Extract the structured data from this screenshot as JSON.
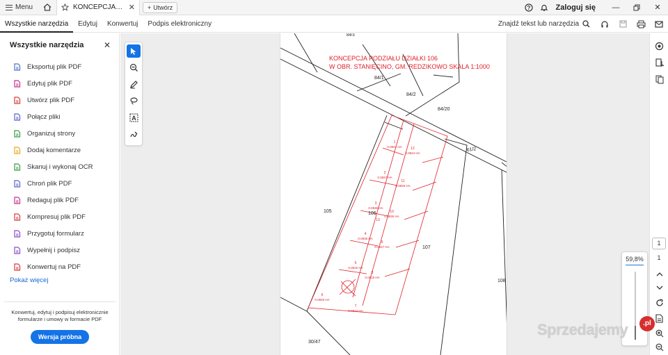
{
  "titlebar": {
    "menu_label": "Menu",
    "tab_title": "KONCEPCJA_PODZ...",
    "new_tab_label": "Utwórz",
    "login_label": "Zaloguj się"
  },
  "menubar": {
    "items": [
      "Wszystkie narzędzia",
      "Edytuj",
      "Konwertuj",
      "Podpis elektroniczny"
    ],
    "find_label": "Znajdź tekst lub narzędzia"
  },
  "left_panel": {
    "heading": "Wszystkie narzędzia",
    "tools": [
      {
        "label": "Eksportuj plik PDF",
        "icon": "export-pdf-icon",
        "color": "#4a76c4"
      },
      {
        "label": "Edytuj plik PDF",
        "icon": "edit-pdf-icon",
        "color": "#c5308a"
      },
      {
        "label": "Utwórz plik PDF",
        "icon": "create-pdf-icon",
        "color": "#d93b3b"
      },
      {
        "label": "Połącz pliki",
        "icon": "combine-files-icon",
        "color": "#5a61cc"
      },
      {
        "label": "Organizuj strony",
        "icon": "organize-pages-icon",
        "color": "#3a9a44"
      },
      {
        "label": "Dodaj komentarze",
        "icon": "comment-icon",
        "color": "#e8a81c"
      },
      {
        "label": "Skanuj i wykonaj OCR",
        "icon": "scan-ocr-icon",
        "color": "#3a9a44"
      },
      {
        "label": "Chroń plik PDF",
        "icon": "protect-pdf-icon",
        "color": "#5a61cc"
      },
      {
        "label": "Redaguj plik PDF",
        "icon": "redact-pdf-icon",
        "color": "#c5308a"
      },
      {
        "label": "Kompresuj plik PDF",
        "icon": "compress-pdf-icon",
        "color": "#d93b3b"
      },
      {
        "label": "Przygotuj formularz",
        "icon": "prepare-form-icon",
        "color": "#8a4cc9"
      },
      {
        "label": "Wypełnij i podpisz",
        "icon": "fill-sign-icon",
        "color": "#8a4cc9"
      },
      {
        "label": "Konwertuj na PDF",
        "icon": "convert-pdf-icon",
        "color": "#d93b3b"
      }
    ],
    "more_label": "Pokaż więcej",
    "promo_text": "Konwertuj, edytuj i podpisuj elektronicznie formularze i umowy w formacie PDF",
    "trial_label": "Wersja próbna"
  },
  "document": {
    "title_line1": "KONCEPCJA PODZIAŁU DZIAŁKI 106",
    "title_line2": "W OBR. STANIĘCINO, GM. REDZIKOWO SKALA 1:1000",
    "labels": {
      "p84_1": "84/1",
      "p84_2": "84/2",
      "p84_20": "84/20",
      "p61_2": "61/2",
      "p105": "105",
      "p106": "106",
      "p107": "107",
      "p108": "108",
      "p30_47": "30/47",
      "top": "84/3"
    },
    "lots": [
      {
        "n": "1",
        "area": "0.0841 HA"
      },
      {
        "n": "2",
        "area": "0.0827 HA"
      },
      {
        "n": "3",
        "area": "0.0826 HA"
      },
      {
        "n": "4",
        "area": "0.0836 HA"
      },
      {
        "n": "5",
        "area": "0.0815 HA"
      },
      {
        "n": "6",
        "area": "0.0826 HA"
      },
      {
        "n": "7",
        "area": "0.0844 HA"
      },
      {
        "n": "8",
        "area": "0.0815 HA"
      },
      {
        "n": "9",
        "area": "0.0827 HA"
      },
      {
        "n": "10",
        "area": "0.0836 HA"
      },
      {
        "n": "11",
        "area": "0.0826 HA"
      },
      {
        "n": "12",
        "area": "0.0824 HA"
      },
      {
        "n": "13",
        "area": ""
      }
    ],
    "accent_color": "#e0202a"
  },
  "right_rail": {
    "current_page": "1",
    "total_pages": "1",
    "zoom": "59,8%",
    "zoom_fraction": 0.2
  },
  "watermark": {
    "text": "Sprzedajemy",
    "badge": ".pl"
  }
}
